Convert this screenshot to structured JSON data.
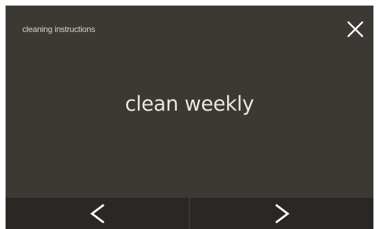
{
  "screen": {
    "title": "cleaning instructions",
    "message": "clean weekly"
  },
  "icons": {
    "close": "close-icon",
    "previous": "chevron-left-icon",
    "next": "chevron-right-icon"
  },
  "colors": {
    "background": "#3c3935",
    "nav_bar": "#2a2725",
    "text": "#ebe8e4"
  }
}
